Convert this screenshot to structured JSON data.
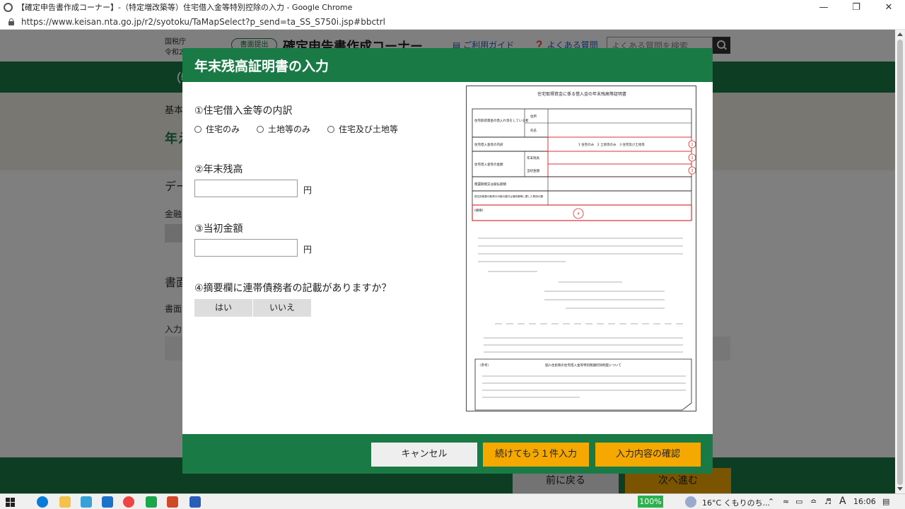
{
  "browser": {
    "window_title": "【確定申告書作成コーナー】-（特定増改築等）住宅借入金等特別控除の入力 - Google Chrome",
    "url": "https://www.keisan.nta.go.jp/r2/syotoku/TaMapSelect?p_send=ta_SS_S750i.jsp#bbctrl",
    "controls": [
      "—",
      "❐",
      "✕"
    ]
  },
  "background_page": {
    "agency": "国税庁",
    "era": "令和2",
    "pill": "書面提出",
    "brand": "確定申告書作成コーナー",
    "guide_link": "ご利用ガイド",
    "faq_link": "よくある質問",
    "search_placeholder": "よくある質問を検索",
    "green_band_text": "（特",
    "crumb": "基本",
    "heading_big": "年え",
    "section1": "デー",
    "label1": "金融",
    "section2": "書面",
    "label2": "書面",
    "label3": "入力",
    "back_button": "前に戻る",
    "next_button": "次へ進む"
  },
  "modal": {
    "title": "年末残高証明書の入力",
    "q1": "①住宅借入金等の内訳",
    "q1_options": [
      "住宅のみ",
      "土地等のみ",
      "住宅及び土地等"
    ],
    "q2": "②年末残高",
    "q2_value": "",
    "q3": "③当初金額",
    "q3_value": "",
    "yen": "円",
    "q4": "④摘要欄に連帯債務者の記載がありますか？",
    "q4_options": [
      "はい",
      "いいえ"
    ],
    "cancel_button": "キャンセル",
    "continue_button": "続けてもう１件入力",
    "confirm_button": "入力内容の確認"
  },
  "document": {
    "title": "住宅取得資金に係る借入金の年末残高等証明書",
    "row_labels": [
      "住宅取得資金の借入れ等をしている者",
      "住宅借入金等の内訳",
      "住宅借入金等の金額",
      "償還期間又は賦払期間",
      "居住用家屋の取得の対価の額又は増改築等に要した費用の額",
      "(摘要)"
    ],
    "sub_labels": [
      "住所",
      "氏名",
      "年末残高",
      "当初金額"
    ],
    "kinds": "1 住宅のみ　2 土地等のみ　3 住宅及び土地等",
    "markers": [
      "1",
      "2",
      "3",
      "4"
    ],
    "reference_box_title": "個人住民税の住宅借入金等特別税額控除制度について",
    "reference_tag": "〈参考〉"
  },
  "taskbar": {
    "battery": "100%",
    "weather": "16°C くもりのち...",
    "ime": "A",
    "time": "16:06"
  }
}
